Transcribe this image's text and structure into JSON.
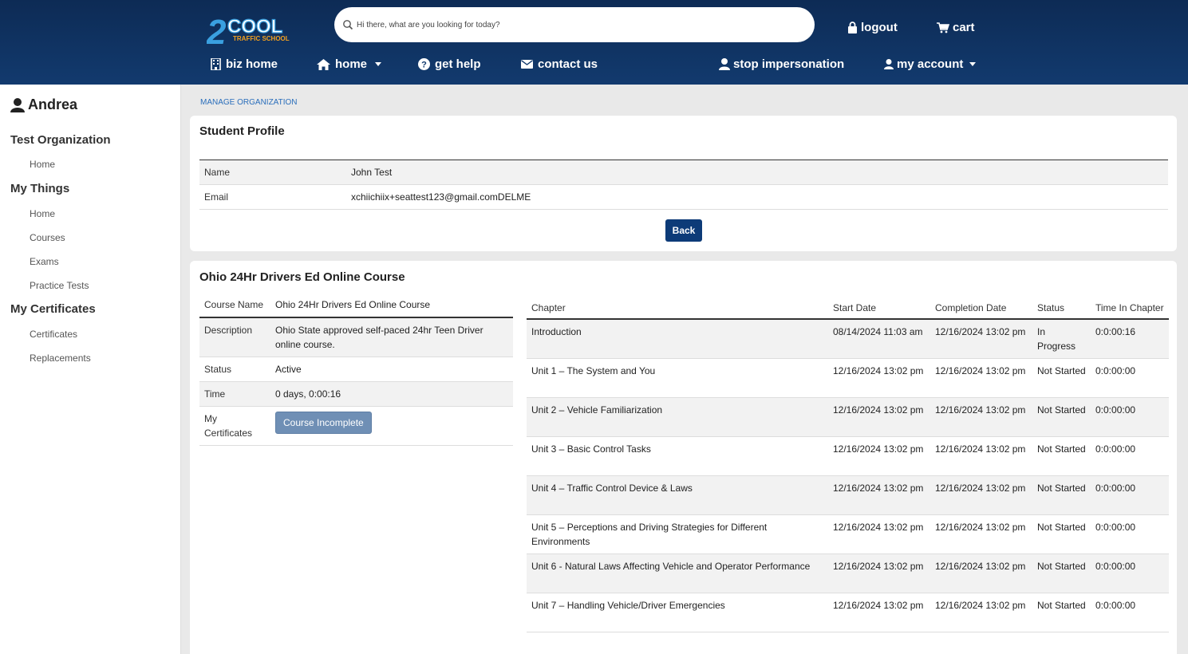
{
  "header": {
    "logo_text": "2COOL",
    "logo_sub": "TRAFFIC SCHOOL",
    "search_placeholder": "Hi there, what are you looking for today?",
    "logout": "logout",
    "cart": "cart",
    "nav": {
      "biz_home": "biz home",
      "home": "home",
      "get_help": "get help",
      "contact_us": "contact us",
      "stop_impersonation": "stop impersonation",
      "my_account": "my account"
    }
  },
  "sidebar": {
    "user": "Andrea",
    "org_heading": "Test Organization",
    "org_items": [
      "Home"
    ],
    "things_heading": "My Things",
    "things_items": [
      "Home",
      "Courses",
      "Exams",
      "Practice Tests"
    ],
    "certs_heading": "My Certificates",
    "certs_items": [
      "Certificates",
      "Replacements"
    ]
  },
  "breadcrumb": "MANAGE ORGANIZATION",
  "profile": {
    "title": "Student Profile",
    "name_label": "Name",
    "name_value": "John Test",
    "email_label": "Email",
    "email_value": "xchiichiix+seattest123@gmail.comDELME",
    "back_button": "Back"
  },
  "course": {
    "title": "Ohio 24Hr Drivers Ed Online Course",
    "course_name_label": "Course Name",
    "course_name_value": "Ohio 24Hr Drivers Ed Online Course",
    "description_label": "Description",
    "description_value": "Ohio State approved self-paced 24hr Teen Driver online course.",
    "status_label": "Status",
    "status_value": "Active",
    "time_label": "Time",
    "time_value": "0 days, 0:00:16",
    "certificates_label": "My Certificates",
    "certificates_button": "Course Incomplete"
  },
  "chapters": {
    "headers": [
      "Chapter",
      "Start Date",
      "Completion Date",
      "Status",
      "Time In Chapter"
    ],
    "rows": [
      [
        "Introduction",
        "08/14/2024 11:03 am",
        "12/16/2024 13:02 pm",
        "In Progress",
        "0:0:00:16"
      ],
      [
        "Unit 1 – The System and You",
        "12/16/2024 13:02 pm",
        "12/16/2024 13:02 pm",
        "Not Started",
        "0:0:00:00"
      ],
      [
        "Unit 2 – Vehicle Familiarization",
        "12/16/2024 13:02 pm",
        "12/16/2024 13:02 pm",
        "Not Started",
        "0:0:00:00"
      ],
      [
        "Unit 3 – Basic Control Tasks",
        "12/16/2024 13:02 pm",
        "12/16/2024 13:02 pm",
        "Not Started",
        "0:0:00:00"
      ],
      [
        "Unit 4 – Traffic Control Device & Laws",
        "12/16/2024 13:02 pm",
        "12/16/2024 13:02 pm",
        "Not Started",
        "0:0:00:00"
      ],
      [
        "Unit 5 – Perceptions and Driving Strategies for Different Environments",
        "12/16/2024 13:02 pm",
        "12/16/2024 13:02 pm",
        "Not Started",
        "0:0:00:00"
      ],
      [
        "Unit 6 - Natural Laws Affecting Vehicle and Operator Performance",
        "12/16/2024 13:02 pm",
        "12/16/2024 13:02 pm",
        "Not Started",
        "0:0:00:00"
      ],
      [
        "Unit 7 – Handling Vehicle/Driver Emergencies",
        "12/16/2024 13:02 pm",
        "12/16/2024 13:02 pm",
        "Not Started",
        "0:0:00:00"
      ]
    ]
  }
}
